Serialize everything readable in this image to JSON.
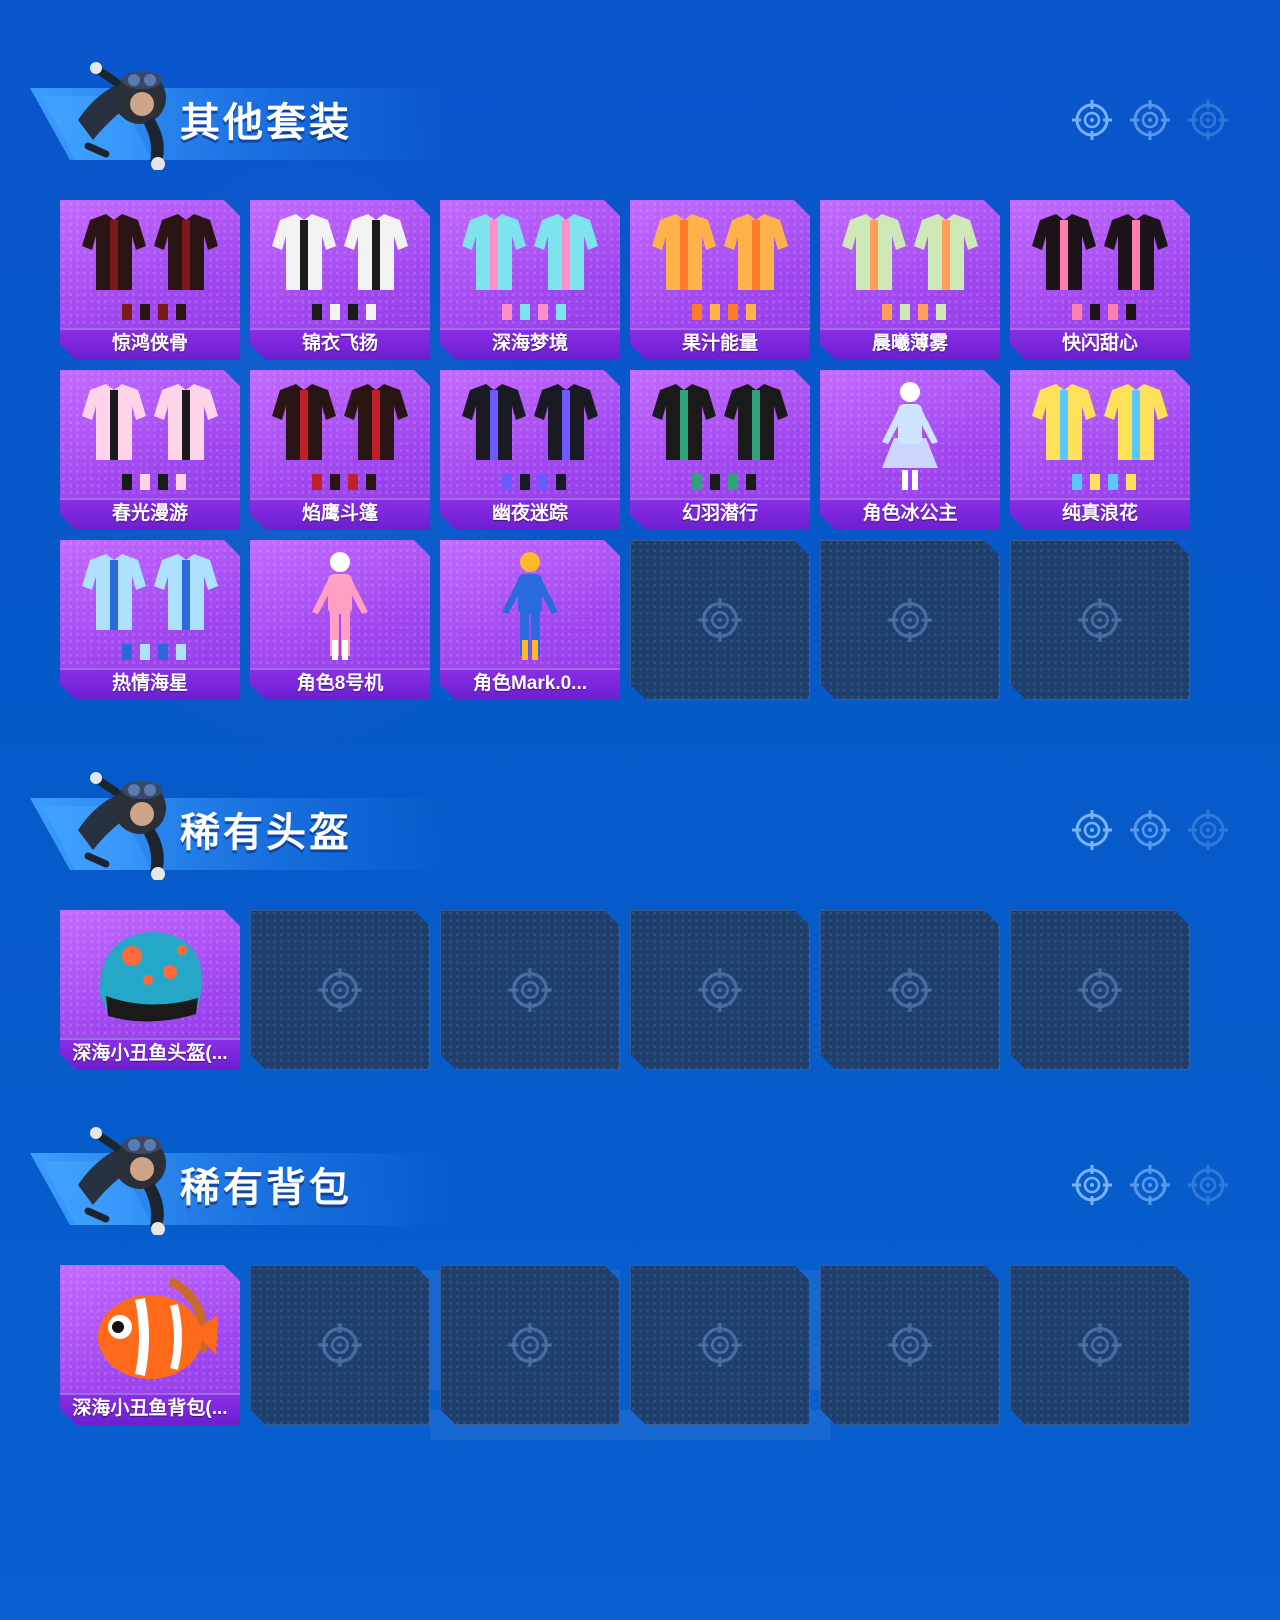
{
  "sections": [
    {
      "title": "其他套装",
      "items": [
        {
          "name": "惊鸿侠骨",
          "art": "outfit-black-red",
          "c1": "#2a1414",
          "c2": "#7a1a1a"
        },
        {
          "name": "锦衣飞扬",
          "art": "outfit-white-robe",
          "c1": "#f2f2f2",
          "c2": "#1a1a1a"
        },
        {
          "name": "深海梦境",
          "art": "outfit-shark-hoodie",
          "c1": "#7fe3ef",
          "c2": "#ff8fc8"
        },
        {
          "name": "果汁能量",
          "art": "outfit-orange-hoodie",
          "c1": "#ffb24a",
          "c2": "#ff7a2a"
        },
        {
          "name": "晨曦薄雾",
          "art": "outfit-pastel",
          "c1": "#cfe8b8",
          "c2": "#ff9f5a"
        },
        {
          "name": "快闪甜心",
          "art": "outfit-pink-black",
          "c1": "#1c1418",
          "c2": "#ff7fb0"
        },
        {
          "name": "春光漫游",
          "art": "outfit-pink-jacket",
          "c1": "#ffd3e8",
          "c2": "#1a1a1a"
        },
        {
          "name": "焰鹰斗篷",
          "art": "outfit-red-cloak",
          "c1": "#2a1515",
          "c2": "#c0202a"
        },
        {
          "name": "幽夜迷踪",
          "art": "outfit-ninja-purple",
          "c1": "#1a1a22",
          "c2": "#6a5aff"
        },
        {
          "name": "幻羽潜行",
          "art": "outfit-ninja-green",
          "c1": "#1a1a1a",
          "c2": "#2fa27a"
        },
        {
          "name": "角色冰公主",
          "art": "outfit-ice-princess",
          "c1": "#cfe4ff",
          "c2": "#ffffff"
        },
        {
          "name": "纯真浪花",
          "art": "outfit-ocean",
          "c1": "#ffe25a",
          "c2": "#5ac8ff"
        },
        {
          "name": "热情海星",
          "art": "outfit-starfish",
          "c1": "#aee0ff",
          "c2": "#2a6ad8"
        },
        {
          "name": "角色8号机",
          "art": "character-unit-8",
          "c1": "#ff9fc4",
          "c2": "#ffffff"
        },
        {
          "name": "角色Mark.0...",
          "art": "character-mark",
          "c1": "#2a6adf",
          "c2": "#ffb82a"
        },
        {
          "name": "",
          "art": "empty"
        },
        {
          "name": "",
          "art": "empty"
        },
        {
          "name": "",
          "art": "empty"
        }
      ]
    },
    {
      "title": "稀有头盔",
      "items": [
        {
          "name": "深海小丑鱼头盔(...",
          "art": "helmet-clownfish",
          "c1": "#25a7c7",
          "c2": "#ff6a3a"
        },
        {
          "name": "",
          "art": "empty"
        },
        {
          "name": "",
          "art": "empty"
        },
        {
          "name": "",
          "art": "empty"
        },
        {
          "name": "",
          "art": "empty"
        },
        {
          "name": "",
          "art": "empty"
        }
      ]
    },
    {
      "title": "稀有背包",
      "items": [
        {
          "name": "深海小丑鱼背包(...",
          "art": "backpack-clownfish",
          "c1": "#ff6a1a",
          "c2": "#ffffff"
        },
        {
          "name": "",
          "art": "empty"
        },
        {
          "name": "",
          "art": "empty"
        },
        {
          "name": "",
          "art": "empty"
        },
        {
          "name": "",
          "art": "empty"
        },
        {
          "name": "",
          "art": "empty"
        }
      ]
    }
  ],
  "colors": {
    "background": "#0659c8",
    "card_filled": "#a24af0",
    "card_label_bar": "#7a25db",
    "card_empty": "#1e3e6c",
    "reticle": "#8fc3ff"
  },
  "icons": {
    "header_decoration": [
      "reticle-icon",
      "reticle-icon",
      "reticle-icon"
    ],
    "empty_slot": "reticle-icon",
    "mascot": "parachuting-character-icon"
  }
}
